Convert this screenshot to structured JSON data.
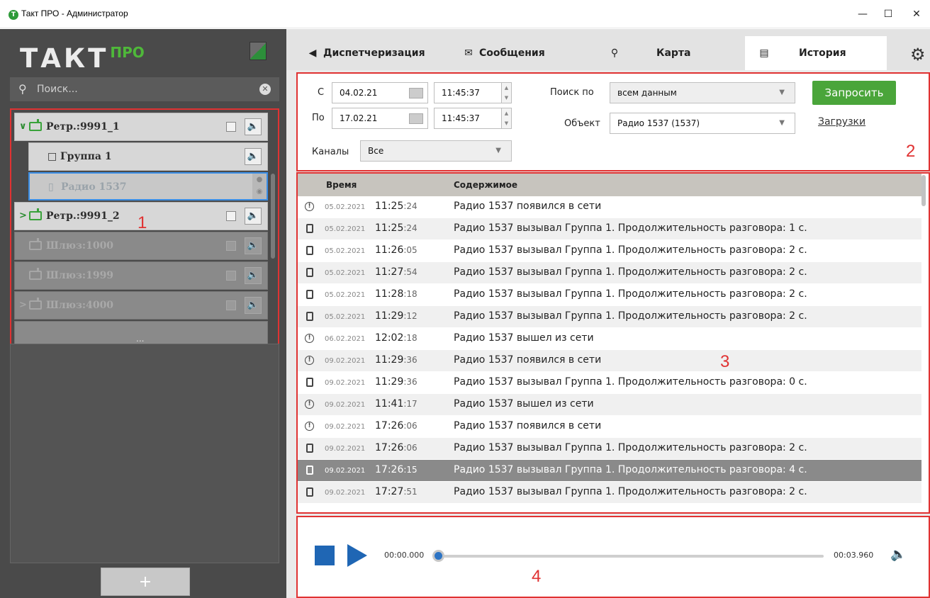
{
  "window": {
    "title": "Такт ПРО - Администратор",
    "icon_letter": "T",
    "minimize": "—",
    "maximize": "☐",
    "close": "✕"
  },
  "sidebar": {
    "logo": "ТАКТ",
    "logo_sup": "ПРО",
    "search_placeholder": "Поиск...",
    "tree": [
      {
        "label": "Ретр.:9991_1",
        "expanded": true
      },
      {
        "label": "Группа 1"
      },
      {
        "label": "Радио 1537",
        "selected": true
      },
      {
        "label": "Ретр.:9991_2",
        "expanded": false
      },
      {
        "label": "Шлюз:1000"
      },
      {
        "label": "Шлюз:1999"
      },
      {
        "label": "Шлюз:4000"
      }
    ],
    "annotation": "1",
    "add_label": "+",
    "dots": "..."
  },
  "tabs": [
    {
      "label": "Диспетчеризация",
      "icon": "speaker-circle-icon"
    },
    {
      "label": "Сообщения",
      "icon": "envelope-icon"
    },
    {
      "label": "Карта",
      "icon": "map-pin-icon"
    },
    {
      "label": "История",
      "icon": "document-icon",
      "active": true
    }
  ],
  "filters": {
    "from_label": "С",
    "to_label": "По",
    "from_date": "04.02.21",
    "from_time": "11:45:37",
    "to_date": "17.02.21",
    "to_time": "11:45:37",
    "search_by_label": "Поиск по",
    "search_by_value": "всем данным",
    "object_label": "Объект",
    "object_value": "Радио 1537 (1537)",
    "channels_label": "Каналы",
    "channels_value": "Все",
    "request_button": "Запросить",
    "downloads_link": "Загрузки",
    "annotation": "2"
  },
  "log": {
    "columns": [
      "Время",
      "Содержимое"
    ],
    "annotation": "3",
    "rows": [
      {
        "type": "info",
        "date": "05.02.2021",
        "time": "11:25",
        "sec": ":24",
        "content": "Радио 1537  появился в сети"
      },
      {
        "type": "radio",
        "date": "05.02.2021",
        "time": "11:25",
        "sec": ":24",
        "content": "Радио 1537 вызывал  Группа 1.  Продолжительность разговора:  1 с."
      },
      {
        "type": "radio",
        "date": "05.02.2021",
        "time": "11:26",
        "sec": ":05",
        "content": "Радио 1537 вызывал  Группа 1.  Продолжительность разговора:  2 с."
      },
      {
        "type": "radio",
        "date": "05.02.2021",
        "time": "11:27",
        "sec": ":54",
        "content": "Радио 1537 вызывал  Группа 1.  Продолжительность разговора:  2 с."
      },
      {
        "type": "radio",
        "date": "05.02.2021",
        "time": "11:28",
        "sec": ":18",
        "content": "Радио 1537 вызывал  Группа 1.  Продолжительность разговора:  2 с."
      },
      {
        "type": "radio",
        "date": "05.02.2021",
        "time": "11:29",
        "sec": ":12",
        "content": "Радио 1537 вызывал  Группа 1.  Продолжительность разговора:  2 с."
      },
      {
        "type": "info",
        "date": "06.02.2021",
        "time": "12:02",
        "sec": ":18",
        "content": "Радио 1537  вышел из сети"
      },
      {
        "type": "info",
        "date": "09.02.2021",
        "time": "11:29",
        "sec": ":36",
        "content": "Радио 1537  появился в сети"
      },
      {
        "type": "radio",
        "date": "09.02.2021",
        "time": "11:29",
        "sec": ":36",
        "content": "Радио 1537 вызывал  Группа 1.  Продолжительность разговора:  0 с."
      },
      {
        "type": "info",
        "date": "09.02.2021",
        "time": "11:41",
        "sec": ":17",
        "content": "Радио 1537  вышел из сети"
      },
      {
        "type": "info",
        "date": "09.02.2021",
        "time": "17:26",
        "sec": ":06",
        "content": "Радио 1537  появился в сети"
      },
      {
        "type": "radio",
        "date": "09.02.2021",
        "time": "17:26",
        "sec": ":06",
        "content": "Радио 1537 вызывал  Группа 1.  Продолжительность разговора:  2 с."
      },
      {
        "type": "radio",
        "date": "09.02.2021",
        "time": "17:26",
        "sec": ":15",
        "content": "Радио 1537 вызывал  Группа 1.  Продолжительность разговора:  4 с.",
        "selected": true
      },
      {
        "type": "radio",
        "date": "09.02.2021",
        "time": "17:27",
        "sec": ":51",
        "content": "Радио 1537 вызывал  Группа 1.  Продолжительность разговора:  2 с."
      }
    ]
  },
  "player": {
    "current": "00:00.000",
    "total": "00:03.960",
    "progress": 0.0,
    "annotation": "4"
  },
  "colors": {
    "accent_green": "#4aa53a",
    "player_blue": "#1f66b4",
    "annotation_red": "#e03232"
  }
}
